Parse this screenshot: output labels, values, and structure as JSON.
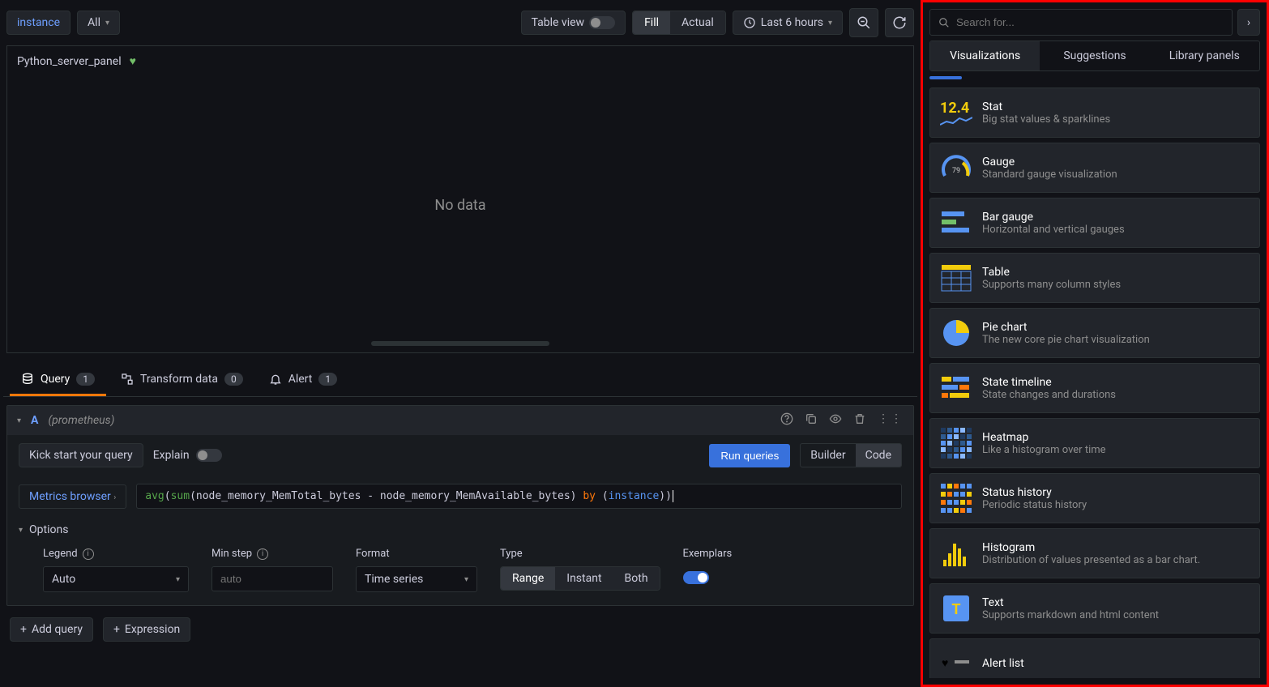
{
  "toolbar": {
    "instance_link": "instance",
    "filter": "All",
    "table_view_label": "Table view",
    "fill_label": "Fill",
    "actual_label": "Actual",
    "time_range": "Last 6 hours"
  },
  "panel": {
    "title": "Python_server_panel",
    "no_data": "No data"
  },
  "tabs": {
    "query_label": "Query",
    "query_count": "1",
    "transform_label": "Transform data",
    "transform_count": "0",
    "alert_label": "Alert",
    "alert_count": "1"
  },
  "query": {
    "id": "A",
    "datasource": "(prometheus)",
    "kick_start": "Kick start your query",
    "explain": "Explain",
    "run_queries": "Run queries",
    "builder": "Builder",
    "code": "Code",
    "metrics_browser": "Metrics browser",
    "expr_fn1": "avg",
    "expr_p1": "(",
    "expr_fn2": "sum",
    "expr_p2": "(node_memory_MemTotal_bytes - node_memory_MemAvailable_bytes) ",
    "expr_kw": "by",
    "expr_p3": " (",
    "expr_id": "instance",
    "expr_p4": "))",
    "options_label": "Options",
    "legend_label": "Legend",
    "legend_value": "Auto",
    "min_step_label": "Min step",
    "min_step_placeholder": "auto",
    "format_label": "Format",
    "format_value": "Time series",
    "type_label": "Type",
    "type_range": "Range",
    "type_instant": "Instant",
    "type_both": "Both",
    "exemplars_label": "Exemplars"
  },
  "footer": {
    "add_query": "Add query",
    "expression": "Expression"
  },
  "right": {
    "search_placeholder": "Search for...",
    "tab_viz": "Visualizations",
    "tab_sug": "Suggestions",
    "tab_lib": "Library panels",
    "items": [
      {
        "title": "Stat",
        "desc": "Big stat values & sparklines",
        "icon": "stat",
        "badge": "12.4"
      },
      {
        "title": "Gauge",
        "desc": "Standard gauge visualization",
        "icon": "gauge"
      },
      {
        "title": "Bar gauge",
        "desc": "Horizontal and vertical gauges",
        "icon": "bargauge"
      },
      {
        "title": "Table",
        "desc": "Supports many column styles",
        "icon": "table"
      },
      {
        "title": "Pie chart",
        "desc": "The new core pie chart visualization",
        "icon": "pie"
      },
      {
        "title": "State timeline",
        "desc": "State changes and durations",
        "icon": "statetl"
      },
      {
        "title": "Heatmap",
        "desc": "Like a histogram over time",
        "icon": "heatmap"
      },
      {
        "title": "Status history",
        "desc": "Periodic status history",
        "icon": "statush"
      },
      {
        "title": "Histogram",
        "desc": "Distribution of values presented as a bar chart.",
        "icon": "histogram"
      },
      {
        "title": "Text",
        "desc": "Supports markdown and html content",
        "icon": "text"
      },
      {
        "title": "Alert list",
        "desc": "",
        "icon": "alertlist"
      }
    ]
  }
}
